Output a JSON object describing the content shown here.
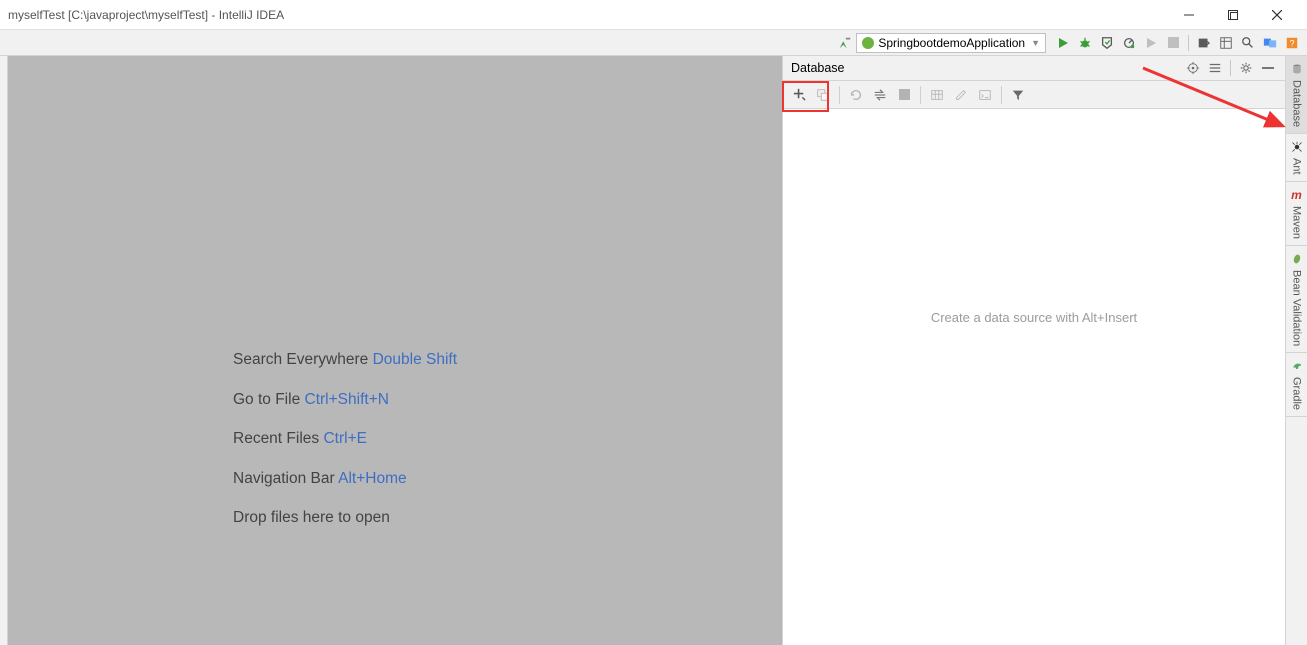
{
  "window": {
    "title": "myselfTest [C:\\javaproject\\myselfTest] - IntelliJ IDEA"
  },
  "toolbar": {
    "run_config": "SpringbootdemoApplication"
  },
  "welcome": {
    "rows": [
      {
        "label": "Search Everywhere",
        "kbd": "Double Shift"
      },
      {
        "label": "Go to File",
        "kbd": "Ctrl+Shift+N"
      },
      {
        "label": "Recent Files",
        "kbd": "Ctrl+E"
      },
      {
        "label": "Navigation Bar",
        "kbd": "Alt+Home"
      },
      {
        "label": "Drop files here to open",
        "kbd": ""
      }
    ]
  },
  "database": {
    "title": "Database",
    "placeholder": "Create a data source with Alt+Insert"
  },
  "right_tabs": {
    "database": "Database",
    "ant": "Ant",
    "maven": "Maven",
    "bean": "Bean Validation",
    "gradle": "Gradle"
  }
}
